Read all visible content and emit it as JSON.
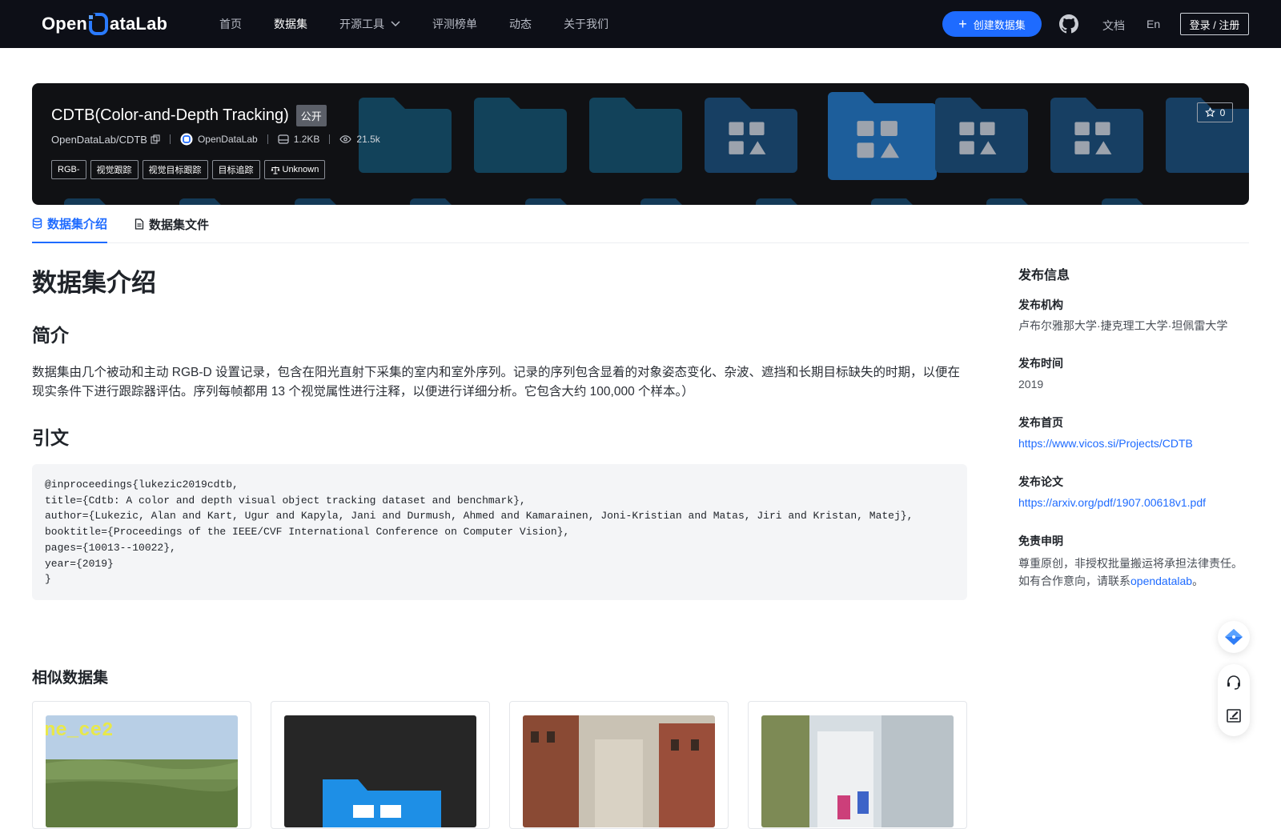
{
  "nav": {
    "logo_text_left": "Open",
    "logo_text_right": "ataLab",
    "links": [
      "首页",
      "数据集",
      "开源工具",
      "评测榜单",
      "动态",
      "关于我们"
    ],
    "active_index": 1,
    "create_label": "创建数据集",
    "docs_label": "文档",
    "lang_label": "En",
    "login_label": "登录 / 注册"
  },
  "banner": {
    "title": "CDTB(Color-and-Depth Tracking)",
    "visibility": "公开",
    "repo_path": "OpenDataLab/CDTB",
    "publisher": "OpenDataLab",
    "size": "1.2KB",
    "views": "21.5k",
    "tags": [
      "RGB-",
      "视觉跟踪",
      "视觉目标跟踪",
      "目标追踪"
    ],
    "license": "Unknown",
    "stars": "0",
    "bg_color": "#101114",
    "folder_color": "#12425a"
  },
  "tabs": [
    {
      "label": "数据集介绍",
      "icon": "database-icon"
    },
    {
      "label": "数据集文件",
      "icon": "file-icon"
    }
  ],
  "main": {
    "heading": "数据集介绍",
    "intro_heading": "简介",
    "intro_text": "数据集由几个被动和主动 RGB-D 设置记录，包含在阳光直射下采集的室内和室外序列。记录的序列包含显着的对象姿态变化、杂波、遮挡和长期目标缺失的时期，以便在现实条件下进行跟踪器评估。序列每帧都用 13 个视觉属性进行注释，以便进行详细分析。它包含大约 100,000 个样本。）",
    "citation_heading": "引文",
    "citation_code": "@inproceedings{lukezic2019cdtb,\ntitle={Cdtb: A color and depth visual object tracking dataset and benchmark},\nauthor={Lukezic, Alan and Kart, Ugur and Kapyla, Jani and Durmush, Ahmed and Kamarainen, Joni-Kristian and Matas, Jiri and Kristan, Matej},\nbooktitle={Proceedings of the IEEE/CVF International Conference on Computer Vision},\npages={10013--10022},\nyear={2019}\n}",
    "similar_heading": "相似数据集",
    "similar_cards": [
      {
        "thumb_text": "ne_ce2"
      },
      {
        "thumb_text": ""
      },
      {
        "thumb_text": ""
      },
      {
        "thumb_text": ""
      }
    ]
  },
  "sidebar": {
    "title": "发布信息",
    "org_label": "发布机构",
    "org_value": "卢布尔雅那大学·捷克理工大学·坦佩雷大学",
    "time_label": "发布时间",
    "time_value": "2019",
    "home_label": "发布首页",
    "home_value": "https://www.vicos.si/Projects/CDTB",
    "paper_label": "发布论文",
    "paper_value": "https://arxiv.org/pdf/1907.00618v1.pdf",
    "disclaimer_label": "免责申明",
    "disclaimer_line1": "尊重原创，非授权批量搬运将承担法律责任。",
    "disclaimer_line2_prefix": "如有合作意向，请联系",
    "disclaimer_link": "opendatalab",
    "disclaimer_suffix": "。"
  },
  "float": {
    "icons": [
      "ai-assistant-icon",
      "headset-icon",
      "feedback-icon"
    ]
  },
  "colors": {
    "accent": "#1e6bff",
    "nav_bg": "#0d0f17"
  }
}
